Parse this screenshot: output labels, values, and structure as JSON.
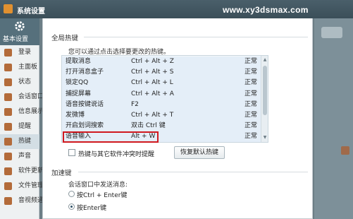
{
  "window": {
    "title": "系统设置",
    "watermark": "www.xy3dsmax.com"
  },
  "sidebar": {
    "header_label": "基本设置",
    "items": [
      {
        "label": "登录",
        "icon": "login-icon"
      },
      {
        "label": "主面板",
        "icon": "panel-icon"
      },
      {
        "label": "状态",
        "icon": "status-icon"
      },
      {
        "label": "会话窗口",
        "icon": "chat-window-icon"
      },
      {
        "label": "信息展示",
        "icon": "info-icon"
      },
      {
        "label": "提醒",
        "icon": "reminder-icon"
      },
      {
        "label": "热键",
        "icon": "hotkey-icon"
      },
      {
        "label": "声音",
        "icon": "sound-icon"
      },
      {
        "label": "软件更新",
        "icon": "update-icon"
      },
      {
        "label": "文件管理",
        "icon": "file-icon"
      },
      {
        "label": "音视频通话",
        "icon": "av-icon"
      }
    ],
    "active_index": 6
  },
  "global_hotkeys": {
    "section_title": "全局热键",
    "hint": "您可以通过点击选择要更改的热键。",
    "rows": [
      {
        "name": "提取消息",
        "key": "Ctrl + Alt + Z",
        "state": "正常"
      },
      {
        "name": "打开消息盒子",
        "key": "Ctrl + Alt + S",
        "state": "正常"
      },
      {
        "name": "锁定QQ",
        "key": "Ctrl + Alt + L",
        "state": "正常"
      },
      {
        "name": "捕捉屏幕",
        "key": "Ctrl + Alt + A",
        "state": "正常"
      },
      {
        "name": "语音按键说话",
        "key": "F2",
        "state": "正常"
      },
      {
        "name": "发微博",
        "key": "Ctrl + Alt + T",
        "state": "正常"
      },
      {
        "name": "开启划词搜索",
        "key": "双击 Ctrl 键",
        "state": "正常"
      },
      {
        "name": "语音输入",
        "key": "Alt + W",
        "state": "正常"
      }
    ],
    "highlighted_row": 7,
    "conflict_checkbox_label": "热键与其它软件冲突时提醒",
    "restore_button_label": "恢复默认热键"
  },
  "accelerator": {
    "section_title": "加速键",
    "send_label": "会话窗口中发送消息:",
    "options": [
      {
        "label": "按Ctrl + Enter键",
        "selected": false
      },
      {
        "label": "按Enter键",
        "selected": true
      }
    ]
  },
  "colors": {
    "highlight_border": "#d0191f",
    "selected_row": "#e4eef8",
    "titlebar": "#3b4f59"
  }
}
